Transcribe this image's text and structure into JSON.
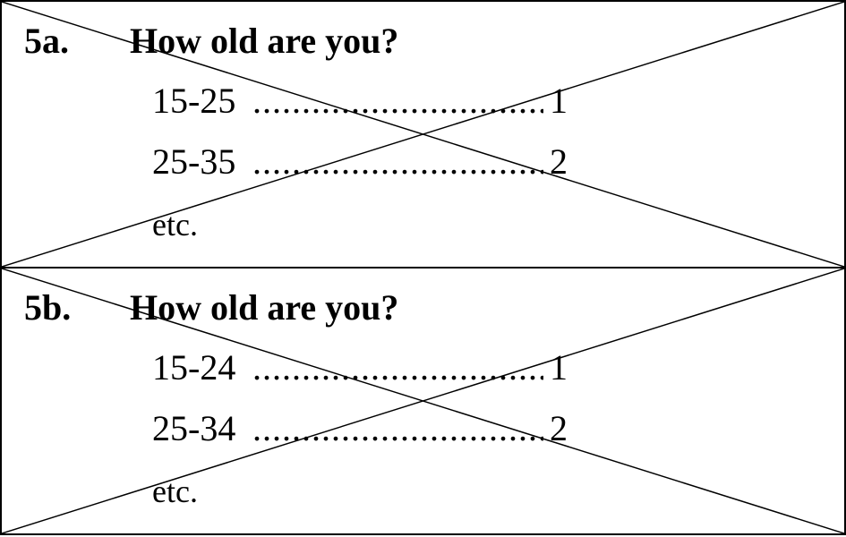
{
  "questions": [
    {
      "number": "5a.",
      "text": "How old are you?",
      "options": [
        {
          "label": "15-25",
          "leader": "..........................................",
          "code": "1"
        },
        {
          "label": "25-35",
          "leader": "..........................................",
          "code": "2"
        }
      ],
      "more": "etc."
    },
    {
      "number": "5b.",
      "text": "How old are you?",
      "options": [
        {
          "label": "15-24",
          "leader": "..........................................",
          "code": "1"
        },
        {
          "label": "25-34",
          "leader": "..........................................",
          "code": "2"
        }
      ],
      "more": "etc."
    }
  ],
  "colors": {
    "ink": "#000000",
    "background": "#ffffff"
  }
}
